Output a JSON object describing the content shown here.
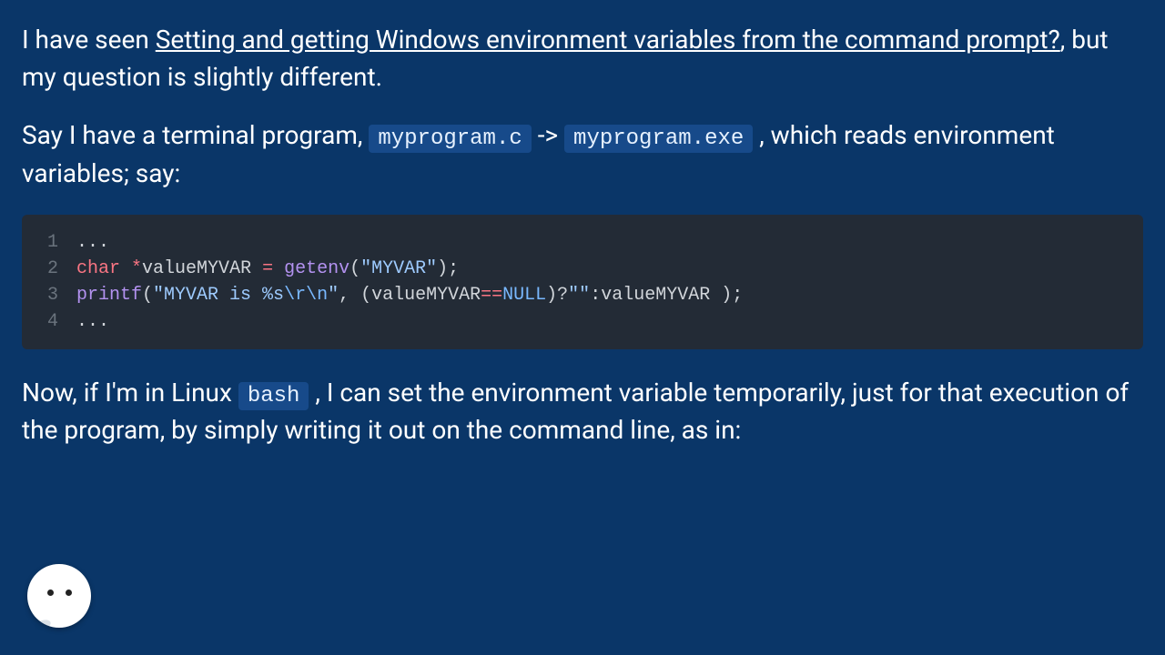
{
  "para1": {
    "prefix": "I have seen ",
    "link": "Setting and getting Windows environment variables from the command prompt?",
    "suffix": ", but my question is slightly different."
  },
  "para2": {
    "part1": "Say I have a terminal program, ",
    "code1": "myprogram.c",
    "arrow": " -> ",
    "code2": "myprogram.exe",
    "part2": " , which reads environment variables; say:"
  },
  "code": {
    "lines": [
      {
        "n": "1",
        "plain": "..."
      },
      {
        "n": "2",
        "raw": "char *valueMYVAR = getenv(\"MYVAR\");"
      },
      {
        "n": "3",
        "raw": "printf(\"MYVAR is %s\\r\\n\", (valueMYVAR==NULL)?\"\":valueMYVAR );"
      },
      {
        "n": "4",
        "plain": "..."
      }
    ]
  },
  "para3": {
    "part1": "Now, if I'm in Linux ",
    "code1": "bash",
    "part2": " , I can set the environment variable temporarily, just for that execution of the program, by simply writing it out on the command line, as in:"
  }
}
